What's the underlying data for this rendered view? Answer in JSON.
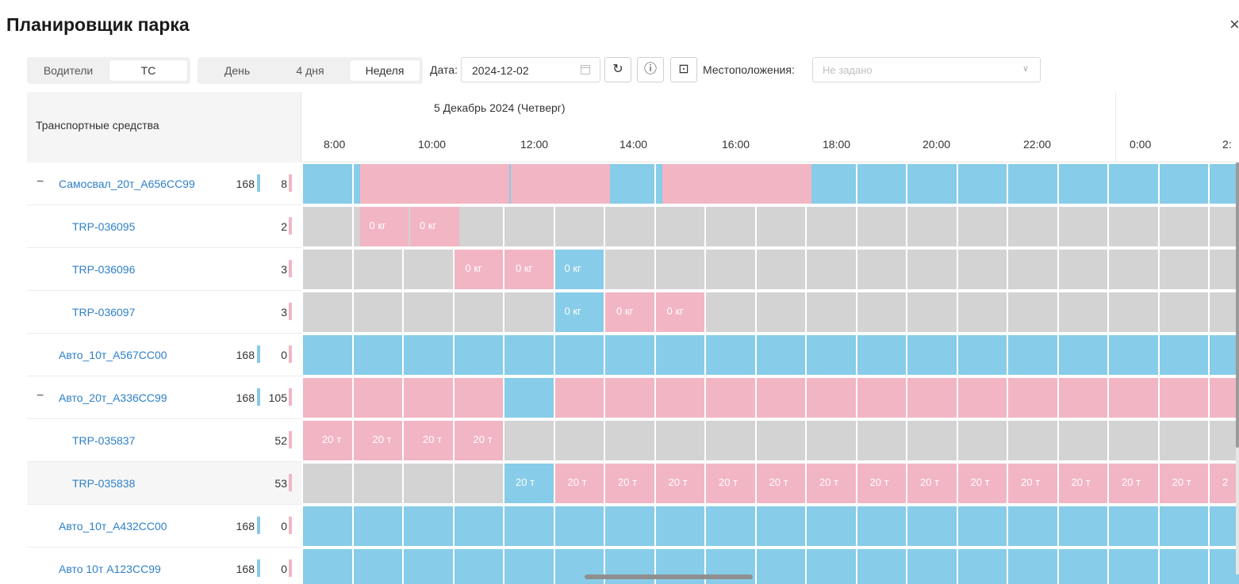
{
  "window": {
    "title": "Планировщик парка",
    "close_icon": "close-icon"
  },
  "toolbar": {
    "resource_tabs": [
      {
        "label": "Водители",
        "active": false
      },
      {
        "label": "ТС",
        "active": true
      }
    ],
    "range_tabs": [
      {
        "label": "День",
        "active": false
      },
      {
        "label": "4 дня",
        "active": false
      },
      {
        "label": "Неделя",
        "active": true
      }
    ],
    "date_label": "Дата:",
    "date_value": "2024-12-02",
    "calendar_icon": "calendar-icon",
    "refresh_icon": "refresh-icon",
    "info_icon": "info-icon",
    "layout_icon": "layout-icon",
    "locations_label": "Местоположения:",
    "locations_placeholder": "Не задано"
  },
  "left_panel": {
    "header": "Транспортные средства"
  },
  "timeline": {
    "day_label": "5 Декабрь 2024 (Четверг)",
    "hours": [
      "8:00",
      "10:00",
      "12:00",
      "14:00",
      "16:00",
      "18:00",
      "20:00",
      "22:00",
      "0:00",
      "2:"
    ]
  },
  "rows": [
    {
      "name": "Самосвал_20т_А656СС99",
      "group": true,
      "collapsed_icon": "minus-icon",
      "capacity": "168",
      "count": "8"
    },
    {
      "name": "TRP-036095",
      "group": false,
      "capacity": "",
      "count": "2"
    },
    {
      "name": "TRP-036096",
      "group": false,
      "capacity": "",
      "count": "3"
    },
    {
      "name": "TRP-036097",
      "group": false,
      "capacity": "",
      "count": "3"
    },
    {
      "name": "Авто_10т_А567СС00",
      "group": false,
      "top": true,
      "capacity": "168",
      "count": "0"
    },
    {
      "name": "Авто_20т_А336СС99",
      "group": true,
      "collapsed_icon": "minus-icon",
      "capacity": "168",
      "count": "105"
    },
    {
      "name": "TRP-035837",
      "group": false,
      "capacity": "",
      "count": "52"
    },
    {
      "name": "TRP-035838",
      "group": false,
      "capacity": "",
      "count": "53"
    },
    {
      "name": "Авто_10т_А432СС00",
      "group": false,
      "top": true,
      "capacity": "168",
      "count": "0"
    },
    {
      "name": "Авто 10т А123СС99",
      "group": false,
      "top": true,
      "capacity": "168",
      "count": "0"
    }
  ],
  "cell_labels": {
    "kg": "0 кг",
    "t": "20 т",
    "t_cut": "2"
  },
  "colors": {
    "free": "#87cce8",
    "empty": "#d3d3d3",
    "booked": "#f2b5c4",
    "link": "#2f80c8"
  }
}
